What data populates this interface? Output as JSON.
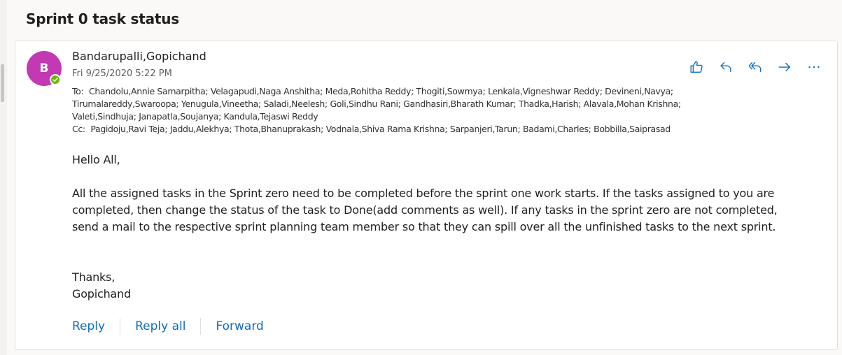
{
  "subject": "Sprint 0 task status",
  "message": {
    "avatar_initial": "B",
    "avatar_color": "#c239b3",
    "presence_color": "#6bb700",
    "sender": "Bandarupalli,Gopichand",
    "datetime": "Fri 9/25/2020 5:22 PM",
    "to_label": "To:",
    "to_lines": [
      "Chandolu,Annie Samarpitha; Velagapudi,Naga Anshitha; Meda,Rohitha Reddy; Thogiti,Sowmya; Lenkala,Vigneshwar Reddy; Devineni,Navya;",
      "Tirumalareddy,Swaroopa; Yenugula,Vineetha; Saladi,Neelesh; Goli,Sindhu Rani; Gandhasiri,Bharath Kumar; Thadka,Harish; Alavala,Mohan Krishna;",
      "Valeti,Sindhuja; Janapatla,Soujanya; Kandula,Tejaswi Reddy"
    ],
    "cc_label": "Cc:",
    "cc": "Pagidoju,Ravi Teja; Jaddu,Alekhya; Thota,Bhanuprakash; Vodnala,Shiva Rama Krishna; Sarpanjeri,Tarun; Badami,Charles; Bobbilla,Saiprasad",
    "greeting": "Hello All,",
    "body_lines": [
      "All the assigned tasks in the Sprint zero need to be completed before the sprint one work starts. If the tasks assigned to you are",
      "completed, then change the status of the task to Done(add comments as well). If any tasks in the sprint zero are not completed,",
      "send a mail to the respective sprint planning team member so that they can spill over all the unfinished tasks to the next sprint."
    ],
    "closing": "Thanks,",
    "signature": "Gopichand"
  },
  "toolbar_icons": [
    "like-icon",
    "reply-icon",
    "reply-all-icon",
    "forward-icon",
    "more-icon"
  ],
  "icon_color": "#0f6cbd",
  "footer": {
    "reply": "Reply",
    "reply_all": "Reply all",
    "forward": "Forward"
  }
}
